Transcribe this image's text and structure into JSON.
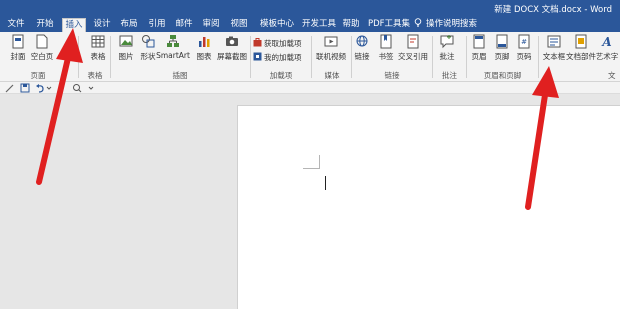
{
  "window": {
    "title": "新建 DOCX 文档.docx  -  Word"
  },
  "tabs": [
    {
      "label": "文件",
      "active": false
    },
    {
      "label": "开始",
      "active": false
    },
    {
      "label": "插入",
      "active": true
    },
    {
      "label": "设计",
      "active": false
    },
    {
      "label": "布局",
      "active": false
    },
    {
      "label": "引用",
      "active": false
    },
    {
      "label": "邮件",
      "active": false
    },
    {
      "label": "审阅",
      "active": false
    },
    {
      "label": "视图",
      "active": false
    },
    {
      "label": "模板中心",
      "active": false
    },
    {
      "label": "开发工具",
      "active": false
    },
    {
      "label": "帮助",
      "active": false
    },
    {
      "label": "PDF工具集",
      "active": false
    }
  ],
  "tell_me": {
    "label": "操作说明搜索",
    "icon": "lightbulb-icon"
  },
  "ribbon": {
    "buttons": {
      "cover": "封面",
      "blank_page": "空白页",
      "table": "表格",
      "picture": "图片",
      "shapes": "形状",
      "smartart": "SmartArt",
      "chart": "图表",
      "screenshot": "屏幕截图",
      "get_addins": "获取加载项",
      "my_addins": "我的加载项",
      "online_video": "联机视频",
      "link": "链接",
      "bookmark": "书签",
      "cross_ref": "交叉引用",
      "comment": "批注",
      "header": "页眉",
      "footer": "页脚",
      "page_number": "页码",
      "text_box": "文本框",
      "quick_parts": "文档部件",
      "wordart": "艺术字"
    },
    "groups": {
      "pages": "页面",
      "tables": "表格",
      "illustrations": "插图",
      "addins": "加载项",
      "media": "媒体",
      "links": "链接",
      "comments": "批注",
      "header_footer": "页眉和页脚",
      "text": "文"
    }
  },
  "colors": {
    "title_bar": "#2b579a",
    "ribbon_bg": "#f3f3f3",
    "annotation_arrow": "#e02020",
    "canvas_bg": "#e6e6e6"
  }
}
